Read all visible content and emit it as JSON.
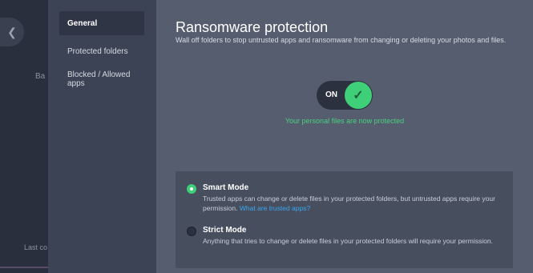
{
  "background": {
    "frag_left": "Ba",
    "frag_bottom": "Last co",
    "back_icon": "chevron-left-icon"
  },
  "sidebar": {
    "items": [
      {
        "label": "General",
        "active": true
      },
      {
        "label": "Protected folders",
        "active": false
      },
      {
        "label": "Blocked / Allowed apps",
        "active": false
      }
    ]
  },
  "main": {
    "title": "Ransomware protection",
    "subtitle": "Wall off folders to stop untrusted apps and ransomware from changing or deleting your photos and files.",
    "toggle": {
      "label": "ON",
      "state": "on",
      "icon": "check-icon"
    },
    "status_text": "Your personal files are now protected",
    "modes": {
      "smart": {
        "title": "Smart Mode",
        "desc": "Trusted apps can change or delete files in your protected folders, but untrusted apps require your permission.",
        "link": "What are trusted apps?",
        "selected": true
      },
      "strict": {
        "title": "Strict Mode",
        "desc": "Anything that tries to change or delete files in your protected folders will require your permission.",
        "selected": false
      }
    }
  },
  "colors": {
    "accent_green": "#3fcf78",
    "link_blue": "#3aa6f0",
    "panel": "#555d6e",
    "sidebar": "#3c4354"
  }
}
